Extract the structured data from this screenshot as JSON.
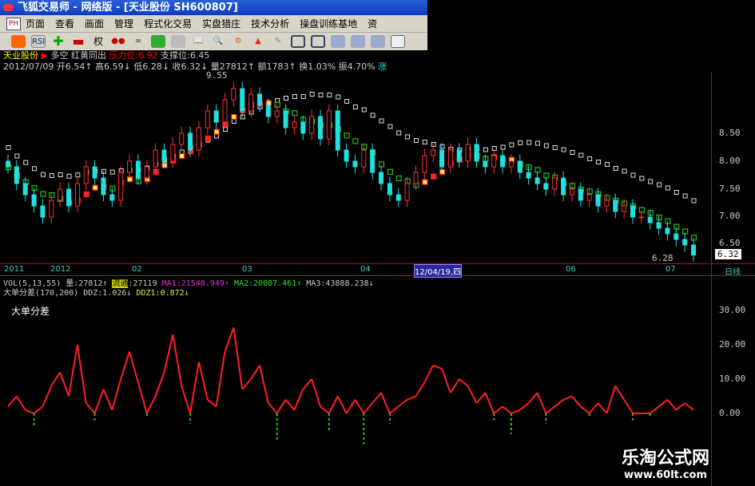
{
  "window": {
    "title": "飞狐交易师 - 网络版 - [天业股份 SH600807]"
  },
  "menu": {
    "app_icon": "app-logo-icon",
    "items": [
      "页面",
      "查看",
      "画面",
      "管理",
      "程式化交易",
      "实盘猎庄",
      "技术分析",
      "操盘训练基地",
      "资"
    ]
  },
  "toolbar": {
    "rsi_label": "RSI",
    "weight_label": "权"
  },
  "info": {
    "stock": "天业股份",
    "arrow": "▶",
    "dk": "多空",
    "signal": "红黄同出",
    "pressure": "压力位:6.92",
    "support": "支撑位:6.45",
    "date": "2012/07/09",
    "open": "开6.54↑",
    "high": "高6.59↓",
    "low": "低6.28↓",
    "close": "收6.32↓",
    "vol": "量27812↑",
    "amount": "额1783↑",
    "turnover": "换1.03%",
    "amplitude": "振4.70%",
    "rise": "涨"
  },
  "price_axis": {
    "labels": [
      "8.50",
      "8.00",
      "7.50",
      "7.00",
      "6.50"
    ],
    "current": "6.32",
    "max_label": "9.55",
    "min_label": "6.28"
  },
  "date_axis": {
    "labels": [
      "2011",
      "2012",
      "02",
      "03",
      "04",
      "12/04/19,四",
      "06",
      "07"
    ],
    "period": "日线"
  },
  "vol_line": {
    "name": "VOL(5,13,55)",
    "vol": "量:27812↑",
    "circ_label": "流通",
    "circ": ":27119",
    "ma1": "MA1:21540.949↑",
    "ma2": "MA2:20087.461↑",
    "ma3": "MA3:43888.238↓"
  },
  "ddz_line": {
    "name": "大单分差(170,200)",
    "ddz": "DDZ:1.026↓",
    "ddz1": "DDZ1:0.872↓"
  },
  "indicator": {
    "title": "大单分差",
    "axis": [
      "30.00",
      "20.00",
      "10.00",
      "0.00"
    ]
  },
  "watermark": {
    "name": "乐淘公式网",
    "url": "www.60lt.com"
  },
  "colors": {
    "up": "#ff3030",
    "down": "#20e0e0",
    "ma_up": "#ff2020",
    "ma_up2": "#ffff30",
    "ma_down": "#20c020",
    "ma_long": "#e0e0e0",
    "ddz_pos": "#ff2020",
    "ddz_neg": "#20d020"
  },
  "chart_data": {
    "type": "candlestick",
    "ylim": [
      6.2,
      9.6
    ],
    "closes": [
      7.9,
      7.6,
      7.4,
      7.2,
      7.0,
      7.3,
      7.5,
      7.2,
      7.6,
      7.9,
      7.7,
      7.4,
      7.3,
      7.8,
      8.0,
      7.7,
      7.9,
      8.2,
      8.0,
      8.3,
      8.5,
      8.2,
      8.6,
      8.9,
      8.7,
      9.1,
      9.3,
      8.9,
      9.2,
      9.0,
      8.8,
      8.9,
      8.6,
      8.7,
      8.5,
      8.8,
      8.4,
      8.9,
      8.2,
      8.0,
      7.9,
      8.2,
      7.8,
      7.6,
      7.4,
      7.3,
      7.6,
      7.8,
      8.1,
      8.2,
      7.9,
      8.2,
      8.0,
      8.3,
      8.0,
      7.9,
      8.1,
      7.9,
      8.0,
      7.8,
      7.7,
      7.6,
      7.5,
      7.7,
      7.4,
      7.5,
      7.3,
      7.4,
      7.2,
      7.3,
      7.1,
      7.2,
      7.0,
      7.0,
      6.9,
      6.8,
      6.7,
      6.6,
      6.5,
      6.32
    ],
    "ddz": [
      2,
      5,
      1,
      -4,
      2,
      8,
      12,
      5,
      20,
      3,
      -2,
      7,
      1,
      10,
      18,
      9,
      -1,
      5,
      12,
      23,
      8,
      -3,
      15,
      4,
      2,
      18,
      25,
      7,
      10,
      14,
      3,
      -8,
      4,
      1,
      7,
      10,
      2,
      -5,
      5,
      0,
      4,
      -9,
      3,
      6,
      -3,
      2,
      4,
      5,
      9,
      14,
      13,
      6,
      10,
      8,
      3,
      6,
      -2,
      2,
      -6,
      1,
      3,
      6,
      -3,
      2,
      4,
      5,
      2,
      -1,
      3,
      0,
      8,
      4,
      -2,
      0,
      -1,
      2,
      4,
      1,
      3,
      1
    ]
  }
}
